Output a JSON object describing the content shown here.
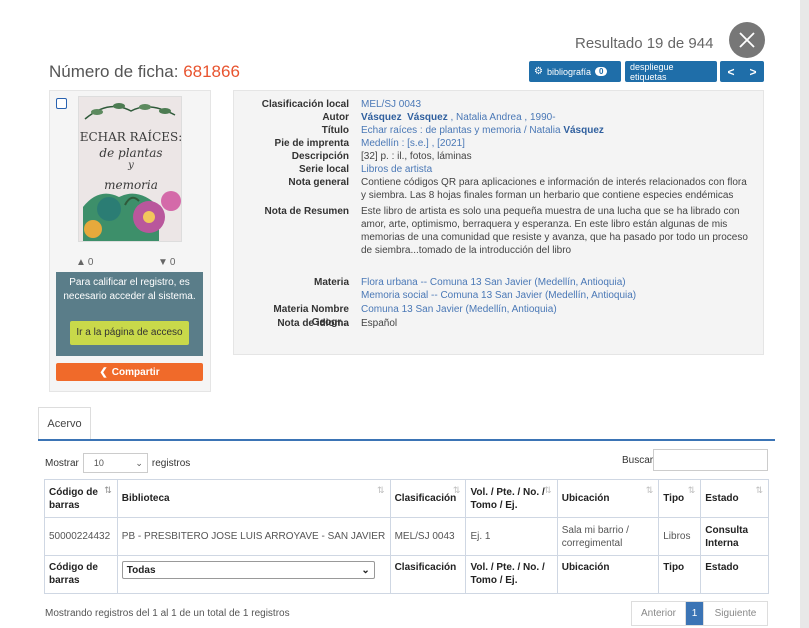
{
  "header": {
    "result_count": "Resultado 19 de 944",
    "ficha_label": "Número de ficha:",
    "ficha_number": "681866"
  },
  "toolbar": {
    "bibliography_label": "bibliografía",
    "bibliography_count": "0",
    "labels_button": "despliegue etiquetas",
    "prev_arrow": "<",
    "next_arrow": ">"
  },
  "cover": {
    "line1": "ECHAR RAÍCES:",
    "line2": "de plantas",
    "line3": "y",
    "line4": "memoria"
  },
  "rating": {
    "likes": "0",
    "dislikes": "0"
  },
  "login": {
    "message": "Para calificar el registro, es necesario acceder al sistema.",
    "button": "Ir a la página de acceso"
  },
  "share": {
    "label": "Compartir"
  },
  "record": {
    "clasificacion": {
      "label": "Clasificación local",
      "value": "MEL/SJ 0043"
    },
    "autor": {
      "label": "Autor",
      "bold1": "Vásquez",
      "bold2": "Vásquez",
      "rest": ", Natalia Andrea , 1990-"
    },
    "titulo": {
      "label": "Título",
      "value": "Echar raíces : de plantas y memoria / Natalia",
      "bold": "Vásquez"
    },
    "pie": {
      "label": "Pie de imprenta",
      "value": "Medellín : [s.e.] , [2021]"
    },
    "descripcion": {
      "label": "Descripción",
      "value": "[32] p. : il., fotos, láminas"
    },
    "serie": {
      "label": "Serie local",
      "value": "Libros de artista"
    },
    "nota_general": {
      "label": "Nota general",
      "value": "Contiene códigos QR para aplicaciones e información de interés relacionados con flora y siembra. Las 8 hojas finales forman un herbario que contiene especies endémicas"
    },
    "nota_resumen": {
      "label": "Nota de Resumen",
      "value": "Este libro de artista es solo una pequeña muestra de una lucha que se ha librado con amor, arte, optimismo, berraquera y esperanza. En este libro están algunas de mis memorias de una comunidad que resiste y avanza, que ha pasado por todo un proceso de siembra...tomado de la introducción del libro"
    },
    "materia": {
      "label": "Materia",
      "value1": "Flora urbana -- Comuna 13 San Javier (Medellín, Antioquia)",
      "value2": "Memoria social -- Comuna 13 San Javier (Medellín, Antioquia)"
    },
    "materia_geo": {
      "label": "Materia Nombre Geogr...",
      "value": "Comuna 13 San Javier (Medellín, Antioquia)"
    },
    "idioma": {
      "label": "Nota de idioma",
      "value": "Español"
    }
  },
  "holdings": {
    "tab": "Acervo",
    "show_label": "Mostrar",
    "show_value": "10",
    "records_label": "registros",
    "search_label": "Buscar:",
    "columns": [
      "Código de barras",
      "Biblioteca",
      "Clasificación",
      "Vol. / Pte. / No. / Tomo / Ej.",
      "Ubicación",
      "Tipo",
      "Estado"
    ],
    "row": {
      "barcode": "50000224432",
      "library": "PB - PRESBITERO JOSE LUIS ARROYAVE - SAN JAVIER",
      "classification": "MEL/SJ 0043",
      "vol": "Ej. 1",
      "location": "Sala mi barrio / corregimental",
      "type": "Libros",
      "status": "Consulta Interna"
    },
    "filter_library": "Todas",
    "info": "Mostrando registros del 1 al 1 de un total de 1 registros",
    "pager": {
      "prev": "Anterior",
      "current": "1",
      "next": "Siguiente"
    }
  }
}
